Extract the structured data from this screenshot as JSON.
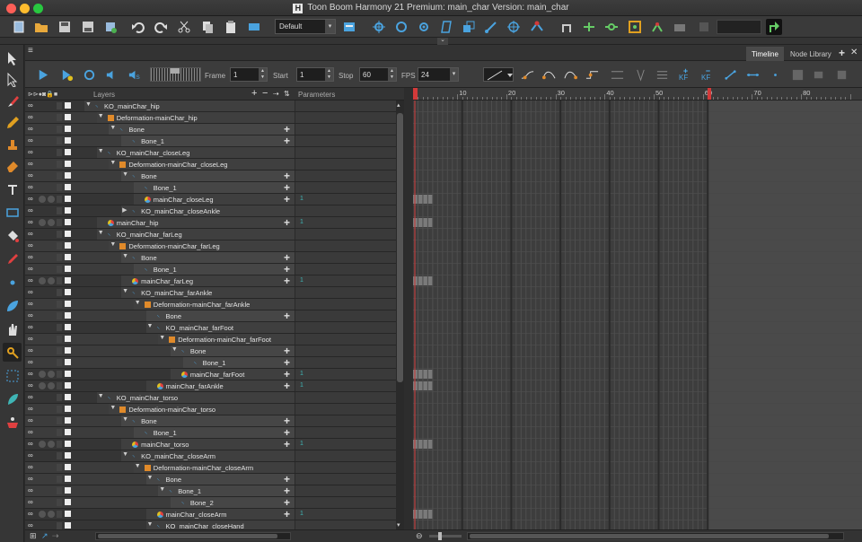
{
  "window": {
    "title": "Toon Boom Harmony 21 Premium: main_char Version: main_char",
    "logo": "H"
  },
  "colors": {
    "accent_blue": "#4aa3df",
    "orange": "#e08a2a",
    "red_marker": "#d23a3a",
    "param_teal": "#3fb5b5"
  },
  "toolbar": {
    "workspace_select": "Default"
  },
  "tabs": {
    "timeline": "Timeline",
    "node_library": "Node Library"
  },
  "playback": {
    "frame_label": "Frame",
    "frame_value": "1",
    "start_label": "Start",
    "start_value": "1",
    "stop_label": "Stop",
    "stop_value": "60",
    "fps_label": "FPS",
    "fps_value": "24"
  },
  "columns": {
    "layers": "Layers",
    "parameters": "Parameters"
  },
  "keyframe_buttons": {
    "kf_in": "KF",
    "kf_out": "KF"
  },
  "timeline": {
    "ruler_numbers": [
      "10",
      "20",
      "30",
      "40",
      "50",
      "60",
      "70",
      "80"
    ],
    "total_frames": 90,
    "scene_end_frame": 60,
    "current_frame": 1
  },
  "layers": [
    {
      "name": "KO_mainChar_hip",
      "type": "peg",
      "depth": 0,
      "expanded": true,
      "plus": false,
      "param": "",
      "key": false
    },
    {
      "name": "Deformation-mainChar_hip",
      "type": "deform",
      "depth": 1,
      "expanded": true,
      "plus": false,
      "param": "",
      "key": false
    },
    {
      "name": "Bone",
      "type": "bone",
      "depth": 2,
      "expanded": true,
      "plus": true,
      "param": "",
      "key": false
    },
    {
      "name": "Bone_1",
      "type": "bone",
      "depth": 3,
      "expanded": false,
      "plus": true,
      "param": "",
      "key": false
    },
    {
      "name": "KO_mainChar_closeLeg",
      "type": "peg",
      "depth": 1,
      "expanded": true,
      "plus": false,
      "param": "",
      "key": false
    },
    {
      "name": "Deformation-mainChar_closeLeg",
      "type": "deform",
      "depth": 2,
      "expanded": true,
      "plus": false,
      "param": "",
      "key": false
    },
    {
      "name": "Bone",
      "type": "bone",
      "depth": 3,
      "expanded": true,
      "plus": true,
      "param": "",
      "key": false
    },
    {
      "name": "Bone_1",
      "type": "bone",
      "depth": 4,
      "expanded": false,
      "plus": true,
      "param": "",
      "key": false
    },
    {
      "name": "mainChar_closeLeg",
      "type": "drawing",
      "depth": 4,
      "expanded": false,
      "plus": true,
      "param": "1",
      "key": true
    },
    {
      "name": "KO_mainChar_closeAnkle",
      "type": "peg",
      "depth": 3,
      "expanded": false,
      "collapsed": true,
      "plus": false,
      "param": "",
      "key": false
    },
    {
      "name": "mainChar_hip",
      "type": "drawing",
      "depth": 1,
      "expanded": false,
      "plus": true,
      "param": "1",
      "key": true
    },
    {
      "name": "KO_mainChar_farLeg",
      "type": "peg",
      "depth": 1,
      "expanded": true,
      "plus": false,
      "param": "",
      "key": false
    },
    {
      "name": "Deformation-mainChar_farLeg",
      "type": "deform",
      "depth": 2,
      "expanded": true,
      "plus": false,
      "param": "",
      "key": false
    },
    {
      "name": "Bone",
      "type": "bone",
      "depth": 3,
      "expanded": true,
      "plus": true,
      "param": "",
      "key": false
    },
    {
      "name": "Bone_1",
      "type": "bone",
      "depth": 4,
      "expanded": false,
      "plus": true,
      "param": "",
      "key": false
    },
    {
      "name": "mainChar_farLeg",
      "type": "drawing",
      "depth": 3,
      "expanded": false,
      "plus": true,
      "param": "1",
      "key": true
    },
    {
      "name": "KO_mainChar_farAnkle",
      "type": "peg",
      "depth": 3,
      "expanded": true,
      "plus": false,
      "param": "",
      "key": false
    },
    {
      "name": "Deformation-mainChar_farAnkle",
      "type": "deform",
      "depth": 4,
      "expanded": true,
      "plus": false,
      "param": "",
      "key": false
    },
    {
      "name": "Bone",
      "type": "bone",
      "depth": 5,
      "expanded": false,
      "plus": true,
      "param": "",
      "key": false
    },
    {
      "name": "KO_mainChar_farFoot",
      "type": "peg",
      "depth": 5,
      "expanded": true,
      "plus": false,
      "param": "",
      "key": false
    },
    {
      "name": "Deformation-mainChar_farFoot",
      "type": "deform",
      "depth": 6,
      "expanded": true,
      "plus": false,
      "param": "",
      "key": false
    },
    {
      "name": "Bone",
      "type": "bone",
      "depth": 7,
      "expanded": true,
      "plus": true,
      "param": "",
      "key": false
    },
    {
      "name": "Bone_1",
      "type": "bone",
      "depth": 8,
      "expanded": false,
      "plus": true,
      "param": "",
      "key": false
    },
    {
      "name": "mainChar_farFoot",
      "type": "drawing",
      "depth": 7,
      "expanded": false,
      "plus": true,
      "param": "1",
      "key": true
    },
    {
      "name": "mainChar_farAnkle",
      "type": "drawing",
      "depth": 5,
      "expanded": false,
      "plus": true,
      "param": "1",
      "key": true
    },
    {
      "name": "KO_mainChar_torso",
      "type": "peg",
      "depth": 1,
      "expanded": true,
      "plus": false,
      "param": "",
      "key": false
    },
    {
      "name": "Deformation-mainChar_torso",
      "type": "deform",
      "depth": 2,
      "expanded": true,
      "plus": false,
      "param": "",
      "key": false
    },
    {
      "name": "Bone",
      "type": "bone",
      "depth": 3,
      "expanded": true,
      "plus": true,
      "param": "",
      "key": false
    },
    {
      "name": "Bone_1",
      "type": "bone",
      "depth": 4,
      "expanded": false,
      "plus": true,
      "param": "",
      "key": false
    },
    {
      "name": "mainChar_torso",
      "type": "drawing",
      "depth": 3,
      "expanded": false,
      "plus": true,
      "param": "1",
      "key": true
    },
    {
      "name": "KO_mainChar_closeArm",
      "type": "peg",
      "depth": 3,
      "expanded": true,
      "plus": false,
      "param": "",
      "key": false
    },
    {
      "name": "Deformation-mainChar_closeArm",
      "type": "deform",
      "depth": 4,
      "expanded": true,
      "plus": false,
      "param": "",
      "key": false
    },
    {
      "name": "Bone",
      "type": "bone",
      "depth": 5,
      "expanded": true,
      "plus": true,
      "param": "",
      "key": false
    },
    {
      "name": "Bone_1",
      "type": "bone",
      "depth": 6,
      "expanded": true,
      "plus": true,
      "param": "",
      "key": false
    },
    {
      "name": "Bone_2",
      "type": "bone",
      "depth": 7,
      "expanded": false,
      "plus": true,
      "param": "",
      "key": false
    },
    {
      "name": "mainChar_closeArm",
      "type": "drawing",
      "depth": 5,
      "expanded": false,
      "plus": true,
      "param": "1",
      "key": true
    },
    {
      "name": "KO_mainChar_closeHand",
      "type": "peg",
      "depth": 5,
      "expanded": true,
      "plus": false,
      "param": "",
      "key": false
    }
  ]
}
